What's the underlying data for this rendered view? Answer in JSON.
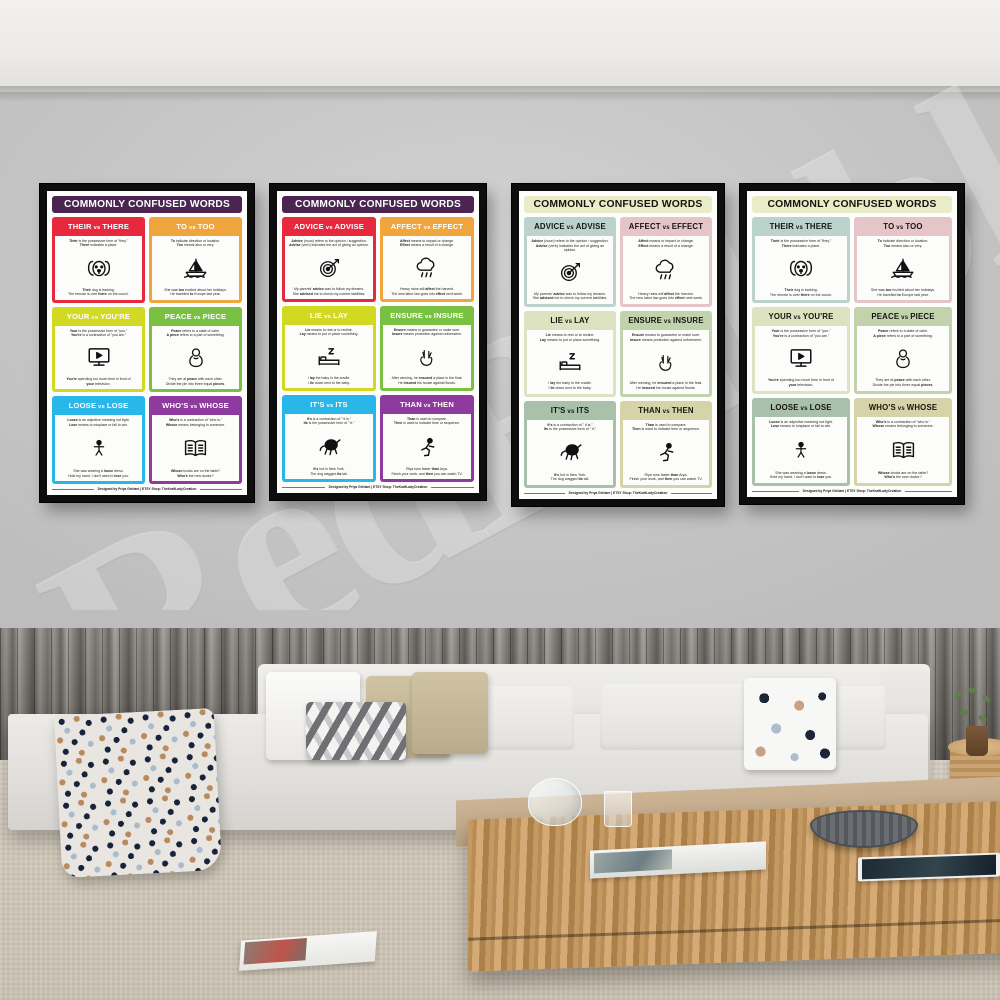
{
  "scene": {
    "watermark_text": "RedBubbleni",
    "description": "Living room mockup with four framed posters on a grey wall"
  },
  "poster_title": "COMMONLY CONFUSED WORDS",
  "credit": "Designed by Priya Gehlani | ETSY Shop: TheKraftLadyCreation",
  "palettes": {
    "bright": {
      "title_bg": "#4b2452",
      "title_fg": "#ffffff",
      "head_fg": "#ffffff",
      "cards": [
        "#e8283c",
        "#f0a63c",
        "#d2d923",
        "#7ac143",
        "#29b6e8",
        "#8e3a9e"
      ]
    },
    "pastel": {
      "title_bg": "#e9ecc6",
      "title_fg": "#15150f",
      "head_fg": "#15150f",
      "cards": [
        "#bcd3cd",
        "#e6c5c9",
        "#dde2c0",
        "#c2d2ad",
        "#a9c0ab",
        "#d7d3a9"
      ]
    }
  },
  "set_a": [
    {
      "head_a": "THEIR",
      "vs": "vs",
      "head_b": "THERE",
      "icon": "dog-icon",
      "def1_bold": "Their",
      "def1_rest": " is the possessive form of \"they.\"",
      "def2_bold": "There",
      "def2_rest": " indicates a place.",
      "ex1_pre": "",
      "ex1_bold": "Their",
      "ex1_post": " dog is barking.",
      "ex2_pre": "The remote is over ",
      "ex2_bold": "there",
      "ex2_post": " on the couch."
    },
    {
      "head_a": "TO",
      "vs": "vs",
      "head_b": "TOO",
      "icon": "sailboat-icon",
      "def1_bold": "To",
      "def1_rest": " indicate direction or location.",
      "def2_bold": "Too",
      "def2_rest": " means also or very.",
      "ex1_pre": "She was ",
      "ex1_bold": "too",
      "ex1_post": " excited about her holidays.",
      "ex2_pre": "He travelled ",
      "ex2_bold": "to",
      "ex2_post": " Europe last year."
    },
    {
      "head_a": "YOUR",
      "vs": "vs",
      "head_b": "YOU'RE",
      "icon": "monitor-play-icon",
      "def1_bold": "Your",
      "def1_rest": " is the possessive form of \"you.\"",
      "def2_bold": "You're",
      "def2_rest": " is a contraction of \"you are.\"",
      "ex1_pre": "",
      "ex1_bold": "You're",
      "ex1_post": " spending too much time in front of",
      "ex2_pre": "",
      "ex2_bold": "your",
      "ex2_post": " television."
    },
    {
      "head_a": "PEACE",
      "vs": "vs",
      "head_b": "PIECE",
      "icon": "dove-icon",
      "def1_bold": "Peace",
      "def1_rest": " refers to a state of calm.",
      "def2_bold": "A piece",
      "def2_rest": " refers to a part of something.",
      "ex1_pre": "They are at ",
      "ex1_bold": "peace",
      "ex1_post": " with each other.",
      "ex2_pre": "Divide the pie into three equal ",
      "ex2_bold": "pieces",
      "ex2_post": "."
    },
    {
      "head_a": "LOOSE",
      "vs": "vs",
      "head_b": "LOSE",
      "icon": "person-icon",
      "def1_bold": "Loose",
      "def1_rest": " is an adjective meaning not tight.",
      "def2_bold": "Lose",
      "def2_rest": " means to misplace or fail to win.",
      "ex1_pre": "She was wearing a ",
      "ex1_bold": "loose",
      "ex1_post": " dress.",
      "ex2_pre": "Hold my hand, I don't want to ",
      "ex2_bold": "lose",
      "ex2_post": " you."
    },
    {
      "head_a": "WHO'S",
      "vs": "vs",
      "head_b": "WHOSE",
      "icon": "open-book-icon",
      "def1_bold": "Who's",
      "def1_rest": " is a contraction of \"who is.\"",
      "def2_bold": "Whose",
      "def2_rest": " means belonging to someone.",
      "ex1_pre": "",
      "ex1_bold": "Whose",
      "ex1_post": " books are on the table?",
      "ex2_pre": "",
      "ex2_bold": "Who's",
      "ex2_post": " the new doctor?"
    }
  ],
  "set_b": [
    {
      "head_a": "ADVICE",
      "vs": "vs",
      "head_b": "ADVISE",
      "icon": "target-arrow-icon",
      "def1_bold": "Advice",
      "def1_rest": " (noun) refers to the opinion / suggestion.",
      "def2_bold": "Advise",
      "def2_rest": " (verb) indicates the act of giving an opinion.",
      "ex1_pre": "My parents' ",
      "ex1_bold": "advice",
      "ex1_post": " was to follow my dreams.",
      "ex2_pre": "She ",
      "ex2_bold": "advised",
      "ex2_post": " me to check my current liabilities."
    },
    {
      "head_a": "AFFECT",
      "vs": "vs",
      "head_b": "EFFECT",
      "icon": "rain-cloud-icon",
      "def1_bold": "Affect",
      "def1_rest": " means to impact or change.",
      "def2_bold": "Effect",
      "def2_rest": " means a result of a change.",
      "ex1_pre": "Heavy rains will ",
      "ex1_bold": "affect",
      "ex1_post": " the harvest.",
      "ex2_pre": "The new labor law goes into ",
      "ex2_bold": "effect",
      "ex2_post": " next week."
    },
    {
      "head_a": "LIE",
      "vs": "vs",
      "head_b": "LAY",
      "icon": "bed-sleep-icon",
      "def1_bold": "Lie",
      "def1_rest": " means to rest or to recline.",
      "def2_bold": "Lay",
      "def2_rest": " means to put or place something.",
      "ex1_pre": "I ",
      "ex1_bold": "lay",
      "ex1_post": " the baby in the cradle.",
      "ex2_pre": "I ",
      "ex2_bold": "lie",
      "ex2_post": " down next to the baby."
    },
    {
      "head_a": "ENSURE",
      "vs": "vs",
      "head_b": "INSURE",
      "icon": "peace-hand-icon",
      "def1_bold": "Ensure",
      "def1_rest": " means to guarantee or make sure.",
      "def2_bold": "Insure",
      "def2_rest": " means protection against unforeseen.",
      "ex1_pre": "After winning, he ",
      "ex1_bold": "ensured",
      "ex1_post": " a place in the final.",
      "ex2_pre": "He ",
      "ex2_bold": "insured",
      "ex2_post": " his house against floods."
    },
    {
      "head_a": "IT'S",
      "vs": "vs",
      "head_b": "ITS",
      "icon": "dog-running-icon",
      "def1_bold": "It's",
      "def1_rest": " is a contraction of \" it is.\"",
      "def2_bold": "Its",
      "def2_rest": " is the possessive form of \" it.\"",
      "ex1_pre": "",
      "ex1_bold": "It's",
      "ex1_post": " hot in New York.",
      "ex2_pre": "The dog wagged ",
      "ex2_bold": "its",
      "ex2_post": " tail."
    },
    {
      "head_a": "THAN",
      "vs": "vs",
      "head_b": "THEN",
      "icon": "running-person-icon",
      "def1_bold": "Than",
      "def1_rest": " is used to compare.",
      "def2_bold": "Then",
      "def2_rest": " is used to indicate time or sequence.",
      "ex1_pre": "Riya runs faster ",
      "ex1_bold": "than",
      "ex1_post": " Arya.",
      "ex2_pre": "Finish your work, and ",
      "ex2_bold": "then",
      "ex2_post": " you can watch TV."
    }
  ],
  "frames": [
    {
      "name": "frame-1",
      "set": "set_a",
      "palette": "bright"
    },
    {
      "name": "frame-2",
      "set": "set_b",
      "palette": "bright"
    },
    {
      "name": "frame-3",
      "set": "set_b",
      "palette": "pastel"
    },
    {
      "name": "frame-4",
      "set": "set_a",
      "palette": "pastel"
    }
  ],
  "room": {
    "items": [
      "plank-wall",
      "sofa",
      "chaise",
      "throw-blanket",
      "cushions",
      "coffee-table",
      "glass-vase",
      "pampas-grass",
      "drinking-glass",
      "metal-bowl",
      "open-magazine",
      "tablet",
      "floor-magazine",
      "wood-stump-table",
      "potted-plant"
    ]
  }
}
